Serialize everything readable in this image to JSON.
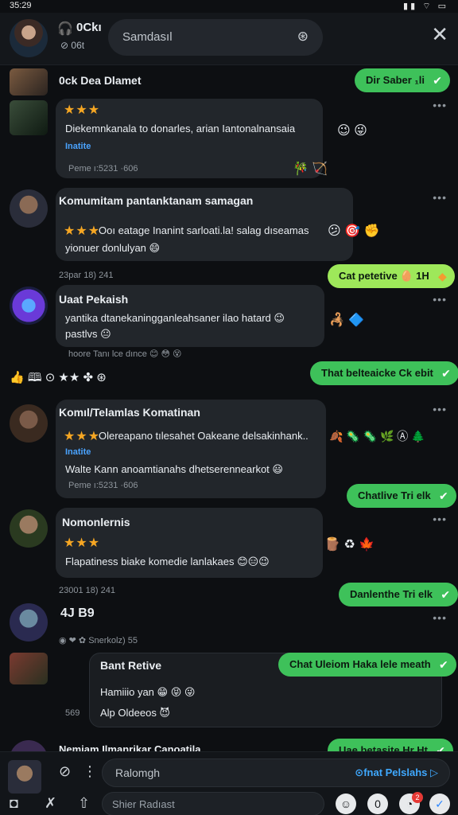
{
  "status": {
    "time": "35:29",
    "sys_icons": "▮▮ ⌔ ▭"
  },
  "header": {
    "name": "0Ckı",
    "sub": "⊘ 06t",
    "headphones_icon": "🎧",
    "search_placeholder": "Samdasıl",
    "search_icon": "⊛",
    "close_icon": "✕"
  },
  "rows": [
    {
      "name": "0ck Dea Dlamet",
      "reply": "Dir Saber ₁li"
    },
    {
      "stars": "★★★",
      "line1": "Diekemnkanala to donarles, arian Iantonalnansaia",
      "link": "Inatite",
      "meta": "Peme ı:5231 ·606",
      "emojis_right": "😉 😜",
      "emojis_below": "🎋 🏹"
    },
    {
      "name": "Komumitam pantanktanam samagan",
      "stars": "★★★",
      "line1": "Ooı eatage Inanint sarloati.la! salag dıseamas",
      "line2": "yionuer donlulyan 😄",
      "emojis_right": "😕 🎯 ✊",
      "reply": "Cat petetive 🥚 1H",
      "ts": "23par 18) 241"
    },
    {
      "name": "Uaat Pekaish",
      "line1": "yantika dtanekaningganleahsaner ilao hatard 😉",
      "line2": "pastlvs 😐",
      "line3": "hoore Tanı lce dınce 😊 😳 😵",
      "emojis_right": "🦂 🔷"
    },
    {
      "icons": "👍 🕮 ⊙ ★★ ✤ ⊛",
      "reply": "That belteaicke Ck ebit"
    },
    {
      "name": "Komıl/Telamlas Komatinan",
      "stars": "★★★",
      "line1": "Olereapano tılesahet Oakeane delsakinhank..",
      "link": "Inatite",
      "line2": "Walte Kann anoamtianahs dhetserennearkot 😃",
      "meta": "Peme ı:5231 ·606",
      "emojis_right": "🍂 🦠 🦠 🌿 Ⓐ 🌲",
      "reply": "Chatlive Tri elk"
    },
    {
      "name": "Nomonlernis",
      "stars": "★★★",
      "line1": "Flapatiness biake komedie lanlakaes 😊😑😉",
      "emojis_right": "🪵 ♻ 🍁",
      "ts": "23001 18) 241",
      "reply": "Danlenthe Tri elk"
    },
    {
      "name": "4J B9",
      "sub": "◉ ❤ ✿ Snerkolz) 55"
    },
    {
      "title": "Bant Retive",
      "line1": "Hamiiio yan 😁 😝 😜",
      "line2": "Alp Oldeeos 😈",
      "left": "569",
      "reply": "Chat Uleiom Haka lele meath"
    },
    {
      "name": "Nemiam Ilmanrikar Canoatila",
      "reply": "Uae betasite Hr Ht"
    }
  ],
  "footer": {
    "input_placeholder": "Ralomgh",
    "input_action": "⊙fnat Pelslahs ▷",
    "compose_placeholder": "Shier Radıast",
    "badge_count": "2"
  }
}
